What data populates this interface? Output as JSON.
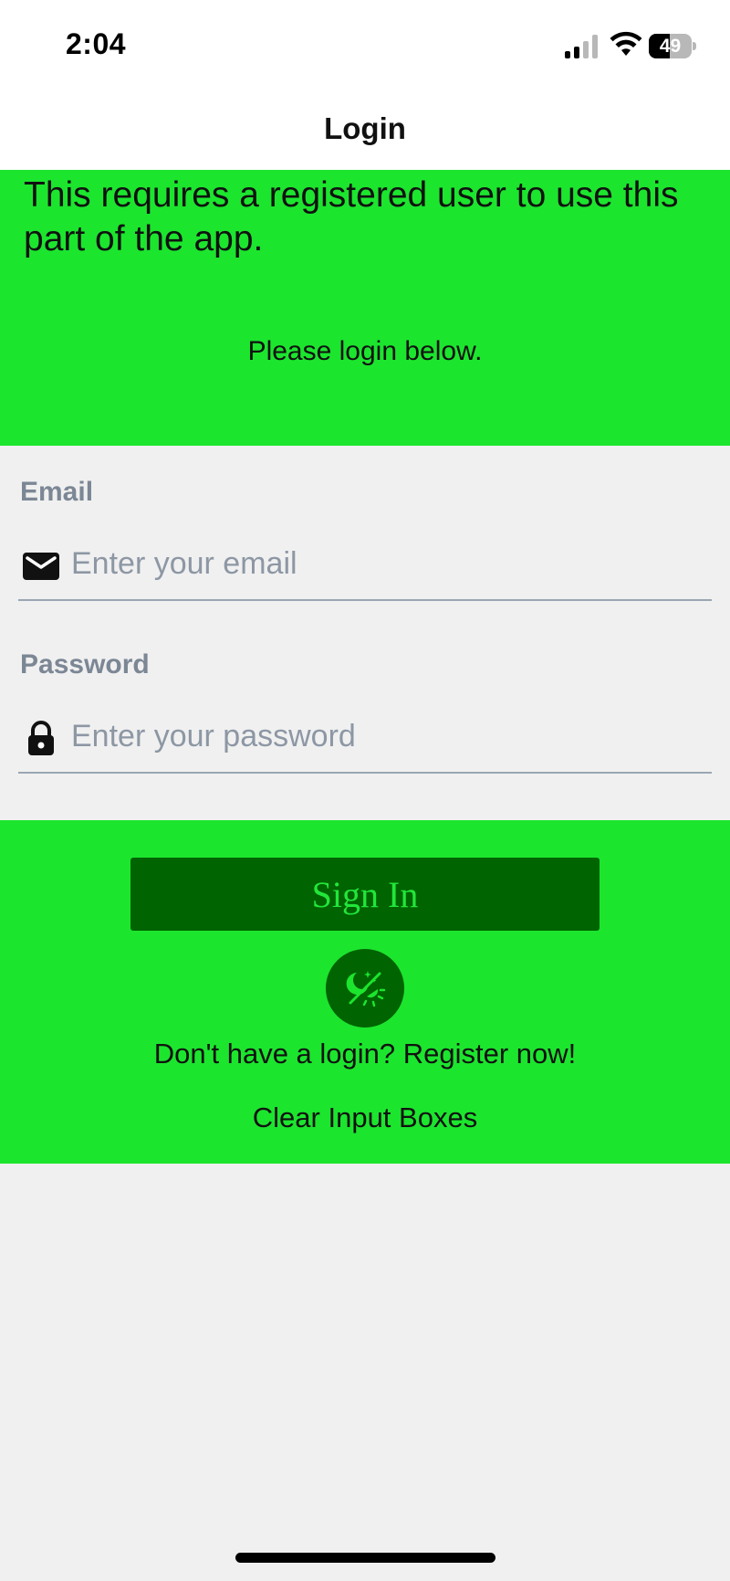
{
  "status_bar": {
    "time": "2:04",
    "battery_percent": "49",
    "battery_level": 0.49
  },
  "nav": {
    "title": "Login"
  },
  "intro": {
    "requires_text": "This requires a registered user to use this part of the app.",
    "please_text": "Please login below."
  },
  "form": {
    "email": {
      "label": "Email",
      "placeholder": "Enter your email",
      "value": "",
      "icon": "envelope-icon"
    },
    "password": {
      "label": "Password",
      "placeholder": "Enter your password",
      "value": "",
      "icon": "lock-icon"
    }
  },
  "actions": {
    "sign_in_label": "Sign In",
    "theme_toggle_icon": "theme-toggle-icon",
    "register_label": "Don't have a login? Register now!",
    "clear_label": "Clear Input Boxes"
  },
  "colors": {
    "accent_green": "#1ce52e",
    "dark_green": "#006400",
    "background": "#f0f0f0",
    "placeholder_gray": "#8d97a4"
  }
}
